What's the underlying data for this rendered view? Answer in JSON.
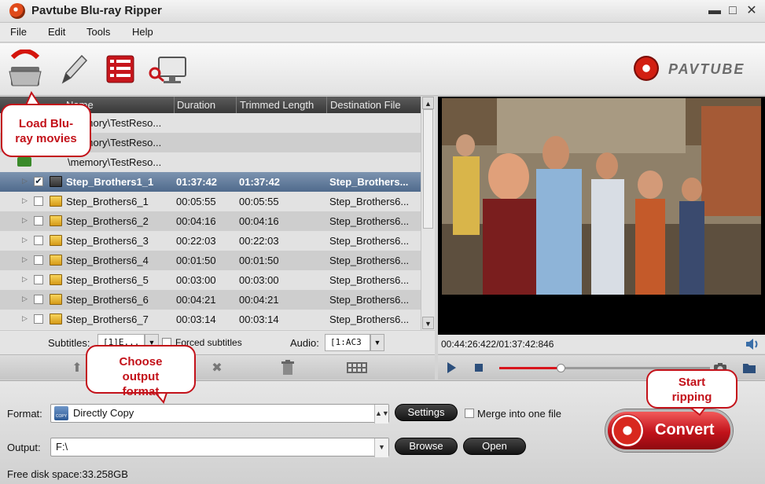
{
  "window": {
    "title": "Pavtube Blu-ray Ripper",
    "min_glyph": "▬",
    "max_glyph": "□",
    "close_glyph": "✕"
  },
  "menu": [
    "File",
    "Edit",
    "Tools",
    "Help"
  ],
  "toolbar": {
    "buttons": [
      "load-folder-icon",
      "edit-pencil-icon",
      "list-merge-icon",
      "screen-snapshot-icon"
    ],
    "brand": "PAVTUBE"
  },
  "list": {
    "columns": [
      "Name",
      "Duration",
      "Trimmed Length",
      "Destination File"
    ],
    "folder_rows": [
      "\\memory\\TestReso...",
      "\\memory\\TestReso...",
      "\\memory\\TestReso..."
    ],
    "rows": [
      {
        "name": "Step_Brothers1_1",
        "duration": "01:37:42",
        "trimmed": "01:37:42",
        "dest": "Step_Brothers...",
        "checked": true,
        "selected": true
      },
      {
        "name": "Step_Brothers6_1",
        "duration": "00:05:55",
        "trimmed": "00:05:55",
        "dest": "Step_Brothers6..."
      },
      {
        "name": "Step_Brothers6_2",
        "duration": "00:04:16",
        "trimmed": "00:04:16",
        "dest": "Step_Brothers6..."
      },
      {
        "name": "Step_Brothers6_3",
        "duration": "00:22:03",
        "trimmed": "00:22:03",
        "dest": "Step_Brothers6..."
      },
      {
        "name": "Step_Brothers6_4",
        "duration": "00:01:50",
        "trimmed": "00:01:50",
        "dest": "Step_Brothers6..."
      },
      {
        "name": "Step_Brothers6_5",
        "duration": "00:03:00",
        "trimmed": "00:03:00",
        "dest": "Step_Brothers6..."
      },
      {
        "name": "Step_Brothers6_6",
        "duration": "00:04:21",
        "trimmed": "00:04:21",
        "dest": "Step_Brothers6..."
      },
      {
        "name": "Step_Brothers6_7",
        "duration": "00:03:14",
        "trimmed": "00:03:14",
        "dest": "Step_Brothers6..."
      }
    ],
    "check_glyph": "✔",
    "subtitles_label": "Subtitles:",
    "subtitles_value": "[1]E...",
    "forced_label": "Forced subtitles",
    "audio_label": "Audio:",
    "audio_value": "[1:AC3"
  },
  "preview": {
    "timecode": "00:44:26:422/01:37:42:846",
    "progress": 0.29
  },
  "bottom": {
    "format_label": "Format:",
    "format_value": "Directly Copy",
    "format_icon_text": "COPY",
    "settings": "Settings",
    "merge_label": "Merge into one file",
    "output_label": "Output:",
    "output_value": "F:\\",
    "browse": "Browse",
    "open": "Open",
    "disk": "Free disk space:33.258GB",
    "convert": "Convert"
  },
  "callouts": {
    "load": "Load Blu-ray movies",
    "format": "Choose output format",
    "start": "Start ripping"
  },
  "colors": {
    "accent": "#c3121a",
    "selected_row": "#5a7496",
    "list_header": "#444444"
  }
}
